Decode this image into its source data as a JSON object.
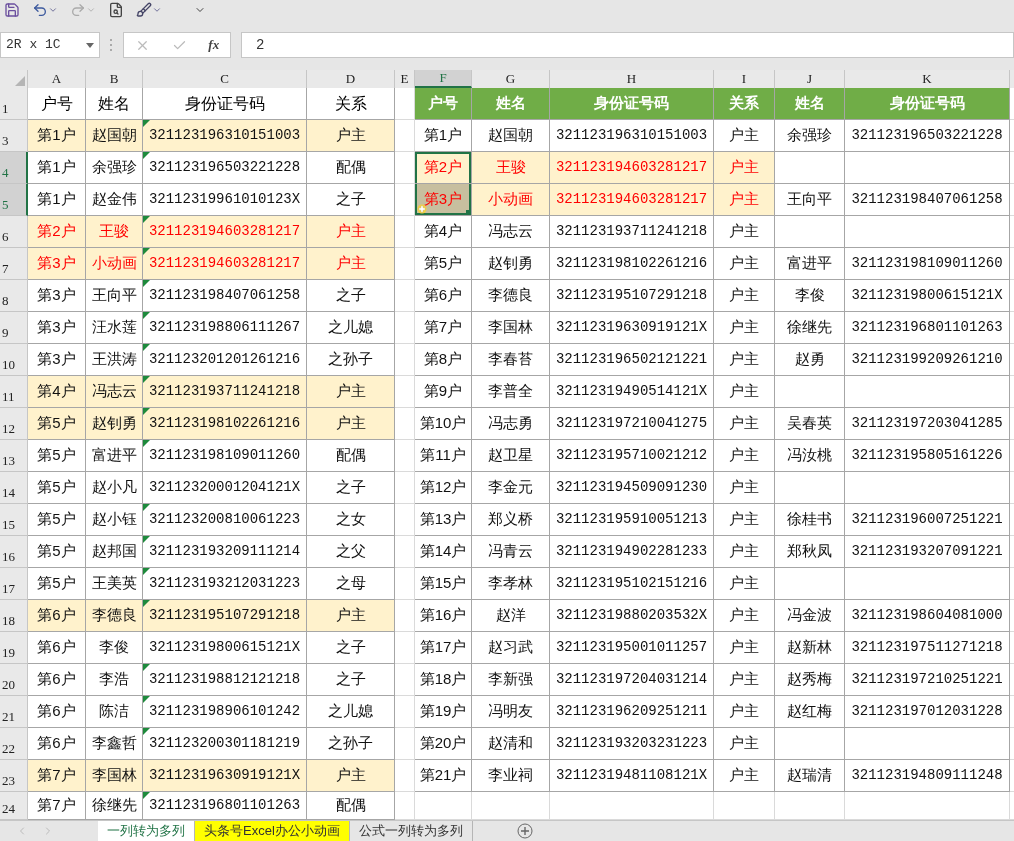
{
  "formula_bar": {
    "name_box": "2R x 1C",
    "fx_label": "fx",
    "value": "2"
  },
  "column_headers": [
    {
      "label": "A",
      "selected": false
    },
    {
      "label": "B",
      "selected": false
    },
    {
      "label": "C",
      "selected": false
    },
    {
      "label": "D",
      "selected": false
    },
    {
      "label": "E",
      "selected": false
    },
    {
      "label": "F",
      "selected": true
    },
    {
      "label": "G",
      "selected": false
    },
    {
      "label": "H",
      "selected": false
    },
    {
      "label": "I",
      "selected": false
    },
    {
      "label": "J",
      "selected": false
    },
    {
      "label": "K",
      "selected": false
    }
  ],
  "row_headers": [
    {
      "label": "1",
      "selected": false
    },
    {
      "label": "3",
      "selected": false
    },
    {
      "label": "4",
      "selected": true
    },
    {
      "label": "5",
      "selected": true
    },
    {
      "label": "6",
      "selected": false
    },
    {
      "label": "7",
      "selected": false
    },
    {
      "label": "8",
      "selected": false
    },
    {
      "label": "9",
      "selected": false
    },
    {
      "label": "10",
      "selected": false
    },
    {
      "label": "11",
      "selected": false
    },
    {
      "label": "12",
      "selected": false
    },
    {
      "label": "13",
      "selected": false
    },
    {
      "label": "14",
      "selected": false
    },
    {
      "label": "15",
      "selected": false
    },
    {
      "label": "16",
      "selected": false
    },
    {
      "label": "17",
      "selected": false
    },
    {
      "label": "18",
      "selected": false
    },
    {
      "label": "19",
      "selected": false
    },
    {
      "label": "20",
      "selected": false
    },
    {
      "label": "21",
      "selected": false
    },
    {
      "label": "22",
      "selected": false
    },
    {
      "label": "23",
      "selected": false
    },
    {
      "label": "24",
      "selected": false
    }
  ],
  "left_table": {
    "columns": [
      "户号",
      "姓名",
      "身份证号码",
      "关系"
    ],
    "rows": [
      {
        "cells": [
          "第1户",
          "赵国朝",
          "321123196310151003",
          "户主"
        ],
        "highlighted": true,
        "red": false,
        "flagged": true
      },
      {
        "cells": [
          "第1户",
          "余强珍",
          "321123196503221228",
          "配偶"
        ],
        "highlighted": false,
        "red": false,
        "flagged": true
      },
      {
        "cells": [
          "第1户",
          "赵金伟",
          "32112319961010123X",
          "之子"
        ],
        "highlighted": false,
        "red": false,
        "flagged": false
      },
      {
        "cells": [
          "第2户",
          "王骏",
          "321123194603281217",
          "户主"
        ],
        "highlighted": true,
        "red": true,
        "flagged": true
      },
      {
        "cells": [
          "第3户",
          "小动画",
          "321123194603281217",
          "户主"
        ],
        "highlighted": true,
        "red": true,
        "flagged": true
      },
      {
        "cells": [
          "第3户",
          "王向平",
          "321123198407061258",
          "之子"
        ],
        "highlighted": false,
        "red": false,
        "flagged": true
      },
      {
        "cells": [
          "第3户",
          "汪水莲",
          "321123198806111267",
          "之儿媳"
        ],
        "highlighted": false,
        "red": false,
        "flagged": true
      },
      {
        "cells": [
          "第3户",
          "王洪涛",
          "321123201201261216",
          "之孙子"
        ],
        "highlighted": false,
        "red": false,
        "flagged": true
      },
      {
        "cells": [
          "第4户",
          "冯志云",
          "321123193711241218",
          "户主"
        ],
        "highlighted": true,
        "red": false,
        "flagged": true
      },
      {
        "cells": [
          "第5户",
          "赵钊勇",
          "321123198102261216",
          "户主"
        ],
        "highlighted": true,
        "red": false,
        "flagged": true
      },
      {
        "cells": [
          "第5户",
          "富进平",
          "321123198109011260",
          "配偶"
        ],
        "highlighted": false,
        "red": false,
        "flagged": true
      },
      {
        "cells": [
          "第5户",
          "赵小凡",
          "32112320001204121X",
          "之子"
        ],
        "highlighted": false,
        "red": false,
        "flagged": false
      },
      {
        "cells": [
          "第5户",
          "赵小钰",
          "321123200810061223",
          "之女"
        ],
        "highlighted": false,
        "red": false,
        "flagged": true
      },
      {
        "cells": [
          "第5户",
          "赵邦国",
          "321123193209111214",
          "之父"
        ],
        "highlighted": false,
        "red": false,
        "flagged": true
      },
      {
        "cells": [
          "第5户",
          "王美英",
          "321123193212031223",
          "之母"
        ],
        "highlighted": false,
        "red": false,
        "flagged": true
      },
      {
        "cells": [
          "第6户",
          "李德良",
          "321123195107291218",
          "户主"
        ],
        "highlighted": true,
        "red": false,
        "flagged": true
      },
      {
        "cells": [
          "第6户",
          "李俊",
          "32112319800615121X",
          "之子"
        ],
        "highlighted": false,
        "red": false,
        "flagged": false
      },
      {
        "cells": [
          "第6户",
          "李浩",
          "321123198812121218",
          "之子"
        ],
        "highlighted": false,
        "red": false,
        "flagged": true
      },
      {
        "cells": [
          "第6户",
          "陈洁",
          "321123198906101242",
          "之儿媳"
        ],
        "highlighted": false,
        "red": false,
        "flagged": true
      },
      {
        "cells": [
          "第6户",
          "李鑫哲",
          "321123200301181219",
          "之孙子"
        ],
        "highlighted": false,
        "red": false,
        "flagged": true
      },
      {
        "cells": [
          "第7户",
          "李国林",
          "32112319630919121X",
          "户主"
        ],
        "highlighted": true,
        "red": false,
        "flagged": false
      },
      {
        "cells": [
          "第7户",
          "徐继先",
          "321123196801101263",
          "配偶"
        ],
        "highlighted": false,
        "red": false,
        "flagged": true
      }
    ]
  },
  "right_table": {
    "columns": [
      "户号",
      "姓名",
      "身份证号码",
      "关系",
      "姓名",
      "身份证号码"
    ],
    "rows": [
      {
        "cells": [
          "第1户",
          "赵国朝",
          "321123196310151003",
          "户主",
          "余强珍",
          "321123196503221228"
        ],
        "highlighted": false,
        "red": false,
        "selected": false
      },
      {
        "cells": [
          "第2户",
          "王骏",
          "321123194603281217",
          "户主"
        ],
        "highlighted": true,
        "red": true,
        "selected": true
      },
      {
        "cells": [
          "第3户",
          "小动画",
          "321123194603281217",
          "户主",
          "王向平",
          "321123198407061258"
        ],
        "highlighted": true,
        "red": true,
        "selected": true
      },
      {
        "cells": [
          "第4户",
          "冯志云",
          "321123193711241218",
          "户主"
        ],
        "highlighted": false,
        "red": false,
        "selected": false
      },
      {
        "cells": [
          "第5户",
          "赵钊勇",
          "321123198102261216",
          "户主",
          "富进平",
          "321123198109011260"
        ],
        "highlighted": false,
        "red": false,
        "selected": false
      },
      {
        "cells": [
          "第6户",
          "李德良",
          "321123195107291218",
          "户主",
          "李俊",
          "32112319800615121X"
        ],
        "highlighted": false,
        "red": false,
        "selected": false
      },
      {
        "cells": [
          "第7户",
          "李国林",
          "32112319630919121X",
          "户主",
          "徐继先",
          "321123196801101263"
        ],
        "highlighted": false,
        "red": false,
        "selected": false
      },
      {
        "cells": [
          "第8户",
          "李春苔",
          "321123196502121221",
          "户主",
          "赵勇",
          "321123199209261210"
        ],
        "highlighted": false,
        "red": false,
        "selected": false
      },
      {
        "cells": [
          "第9户",
          "李普全",
          "32112319490514121X",
          "户主"
        ],
        "highlighted": false,
        "red": false,
        "selected": false
      },
      {
        "cells": [
          "第10户",
          "冯志勇",
          "321123197210041275",
          "户主",
          "吴春英",
          "321123197203041285"
        ],
        "highlighted": false,
        "red": false,
        "selected": false
      },
      {
        "cells": [
          "第11户",
          "赵卫星",
          "321123195710021212",
          "户主",
          "冯汝桃",
          "321123195805161226"
        ],
        "highlighted": false,
        "red": false,
        "selected": false
      },
      {
        "cells": [
          "第12户",
          "李金元",
          "321123194509091230",
          "户主"
        ],
        "highlighted": false,
        "red": false,
        "selected": false
      },
      {
        "cells": [
          "第13户",
          "郑义桥",
          "321123195910051213",
          "户主",
          "徐桂书",
          "321123196007251221"
        ],
        "highlighted": false,
        "red": false,
        "selected": false
      },
      {
        "cells": [
          "第14户",
          "冯青云",
          "321123194902281233",
          "户主",
          "郑秋凤",
          "321123193207091221"
        ],
        "highlighted": false,
        "red": false,
        "selected": false
      },
      {
        "cells": [
          "第15户",
          "李孝林",
          "321123195102151216",
          "户主"
        ],
        "highlighted": false,
        "red": false,
        "selected": false
      },
      {
        "cells": [
          "第16户",
          "赵洋",
          "32112319880203532X",
          "户主",
          "冯金波",
          "321123198604081000"
        ],
        "highlighted": false,
        "red": false,
        "selected": false
      },
      {
        "cells": [
          "第17户",
          "赵习武",
          "321123195001011257",
          "户主",
          "赵新林",
          "321123197511271218"
        ],
        "highlighted": false,
        "red": false,
        "selected": false
      },
      {
        "cells": [
          "第18户",
          "李新强",
          "321123197204031214",
          "户主",
          "赵秀梅",
          "321123197210251221"
        ],
        "highlighted": false,
        "red": false,
        "selected": false
      },
      {
        "cells": [
          "第19户",
          "冯明友",
          "321123196209251211",
          "户主",
          "赵红梅",
          "321123197012031228"
        ],
        "highlighted": false,
        "red": false,
        "selected": false
      },
      {
        "cells": [
          "第20户",
          "赵清和",
          "321123193203231223",
          "户主"
        ],
        "highlighted": false,
        "red": false,
        "selected": false
      },
      {
        "cells": [
          "第21户",
          "李业祠",
          "32112319481108121X",
          "户主",
          "赵瑞清",
          "321123194809111248"
        ],
        "highlighted": false,
        "red": false,
        "selected": false
      }
    ]
  },
  "sheet_tabs": [
    {
      "label": "一列转为多列",
      "selected": true
    },
    {
      "label": "头条号Excel办公小动画",
      "selected": false,
      "color": "#ffff00"
    },
    {
      "label": "公式一列转为多列",
      "selected": false
    }
  ]
}
